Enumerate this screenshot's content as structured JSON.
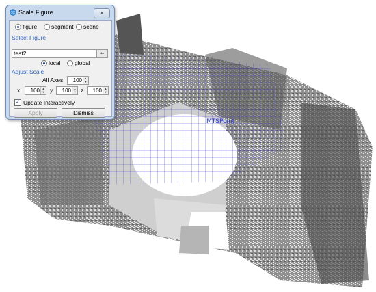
{
  "window": {
    "title": "Scale Figure",
    "close_glyph": "×"
  },
  "mode_radios": [
    {
      "label": "figure",
      "selected": true
    },
    {
      "label": "segment",
      "selected": false
    },
    {
      "label": "scene",
      "selected": false
    }
  ],
  "select_figure": {
    "section_label": "Select Figure",
    "value": "test2",
    "pick_glyph": "⇐"
  },
  "frame_radios": [
    {
      "label": "local",
      "selected": true
    },
    {
      "label": "global",
      "selected": false
    }
  ],
  "adjust_scale": {
    "section_label": "Adjust Scale",
    "all_axes_label": "All Axes:",
    "all_axes_value": "100",
    "x_label": "x",
    "x_value": "100",
    "y_label": "y",
    "y_value": "100",
    "z_label": "z",
    "z_value": "100"
  },
  "update_interactively": {
    "label": "Update Interactively",
    "checked": true,
    "check_glyph": "✓"
  },
  "buttons": {
    "apply": "Apply",
    "dismiss": "Dismiss"
  },
  "scene": {
    "label": "MTSPoint",
    "grid_color": "#3b3bd6"
  }
}
